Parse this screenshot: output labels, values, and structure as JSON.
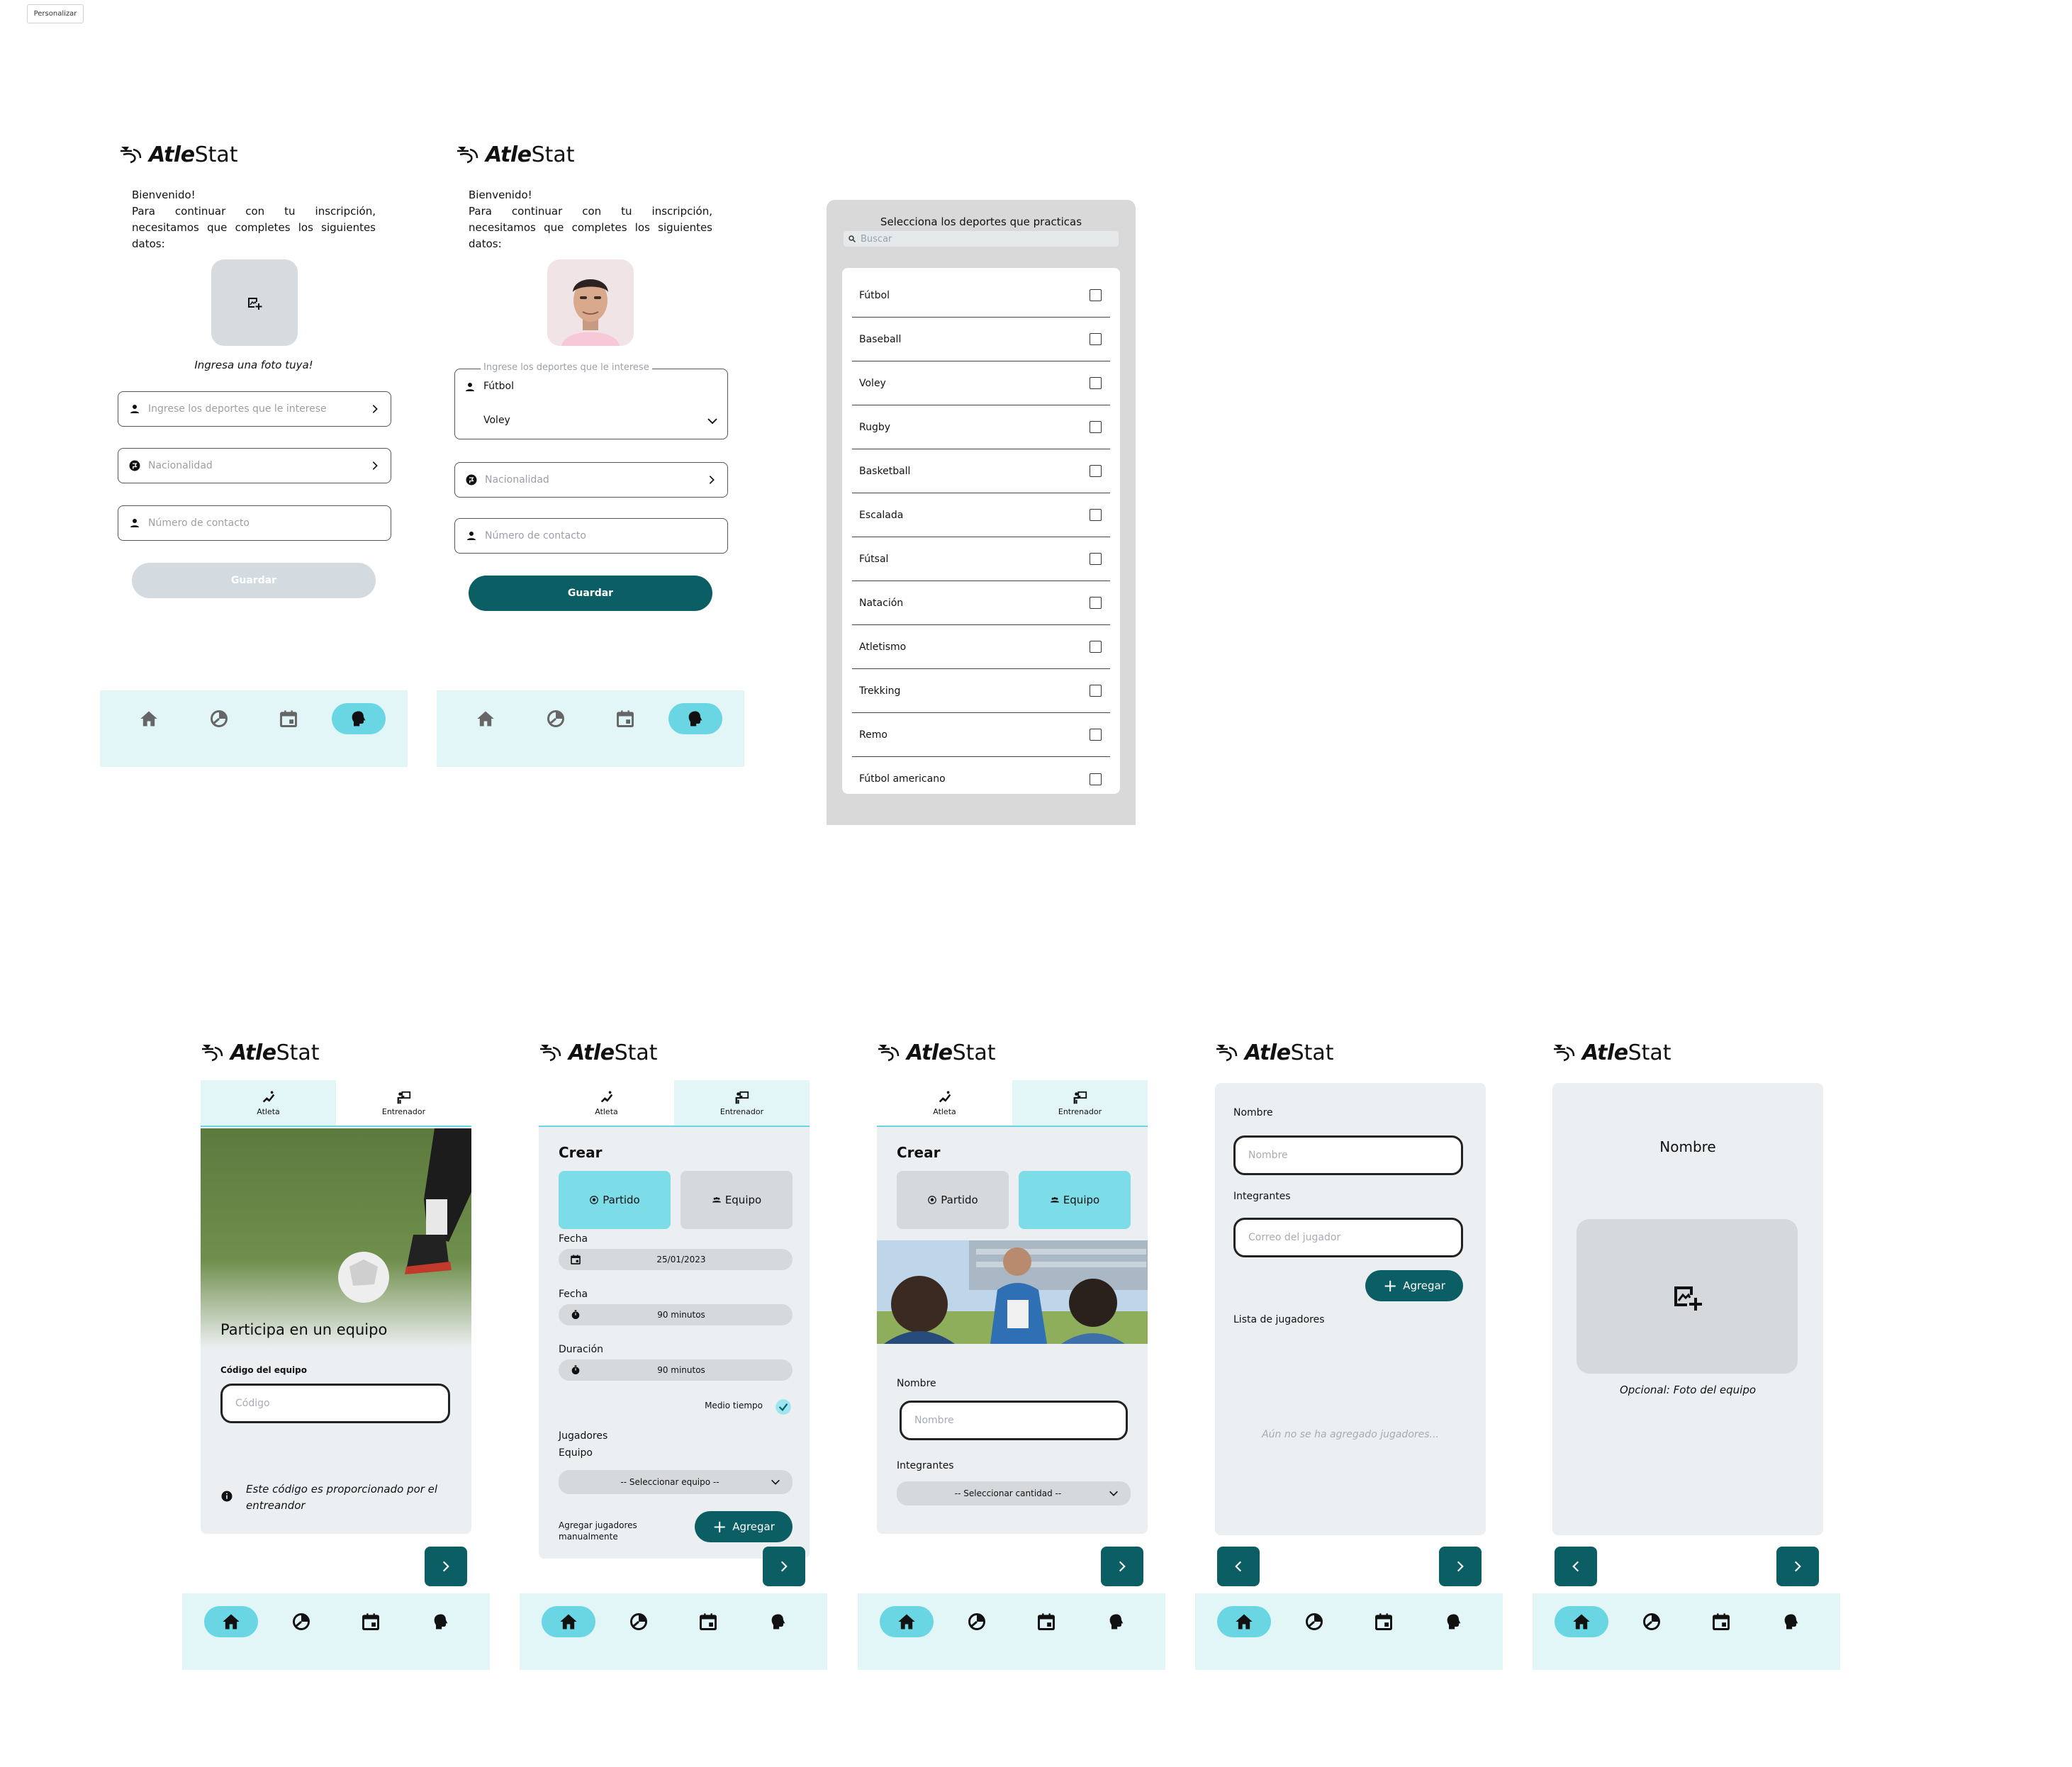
{
  "toolbar": {
    "personalizar": "Personalizar"
  },
  "brand": {
    "atle": "Atle",
    "stat": "Stat"
  },
  "signup": {
    "intro": "Bienvenido!\nPara continuar con tu inscripción, necesitamos que completes los siguientes datos:",
    "photo_caption": "Ingresa una foto tuya!",
    "sports_placeholder": "Ingrese los deportes que le interese",
    "nationality_placeholder": "Nacionalidad",
    "phone_placeholder": "Número de contacto",
    "save_label": "Guardar",
    "selected_sports": [
      "Fútbol",
      "Voley"
    ]
  },
  "sports_picker": {
    "title": "Selecciona los deportes que practicas",
    "search_placeholder": "Buscar",
    "items": [
      "Fútbol",
      "Baseball",
      "Voley",
      "Rugby",
      "Basketball",
      "Escalada",
      "Fútsal",
      "Natación",
      "Atletismo",
      "Trekking",
      "Remo",
      "Fútbol americano"
    ]
  },
  "tabs": {
    "athlete": "Atleta",
    "coach": "Entrenador"
  },
  "join_team": {
    "title": "Participa en un equipo",
    "code_label": "Código del equipo",
    "code_placeholder": "Código",
    "hint": "Este código es proporcionado por el entreandor"
  },
  "create": {
    "title": "Crear",
    "match_label": "Partido",
    "team_label": "Equipo",
    "date_label_1": "Fecha",
    "date_value": "25/01/2023",
    "date_label_2": "Fecha",
    "minutes_value_1": "90 minutos",
    "duration_label": "Duración",
    "minutes_value_2": "90 minutos",
    "half_time_label": "Medio tiempo",
    "players_label": "Jugadores",
    "team_select_label": "Equipo",
    "team_select_value": "-- Seleccionar equipo --",
    "add_manual_label": "Agregar jugadores manualmente",
    "add_label": "Agregar"
  },
  "create_team": {
    "title": "Crear",
    "name_label": "Nombre",
    "name_placeholder": "Nombre",
    "members_label": "Integrantes",
    "members_select_value": "-- Seleccionar cantidad --"
  },
  "team_members": {
    "name_label": "Nombre",
    "name_placeholder": "Nombre",
    "members_label": "Integrantes",
    "email_placeholder": "Correo del jugador",
    "add_label": "Agregar",
    "list_label": "Lista de jugadores",
    "empty_label": "Aún no se ha agregado jugadores..."
  },
  "team_photo": {
    "title": "Nombre",
    "caption": "Opcional: Foto del equipo"
  },
  "colors": {
    "primary": "#0b5e63",
    "accent": "#6ad6e3",
    "nav_bg": "#e2f6f8",
    "card_gray": "#eceff1"
  }
}
